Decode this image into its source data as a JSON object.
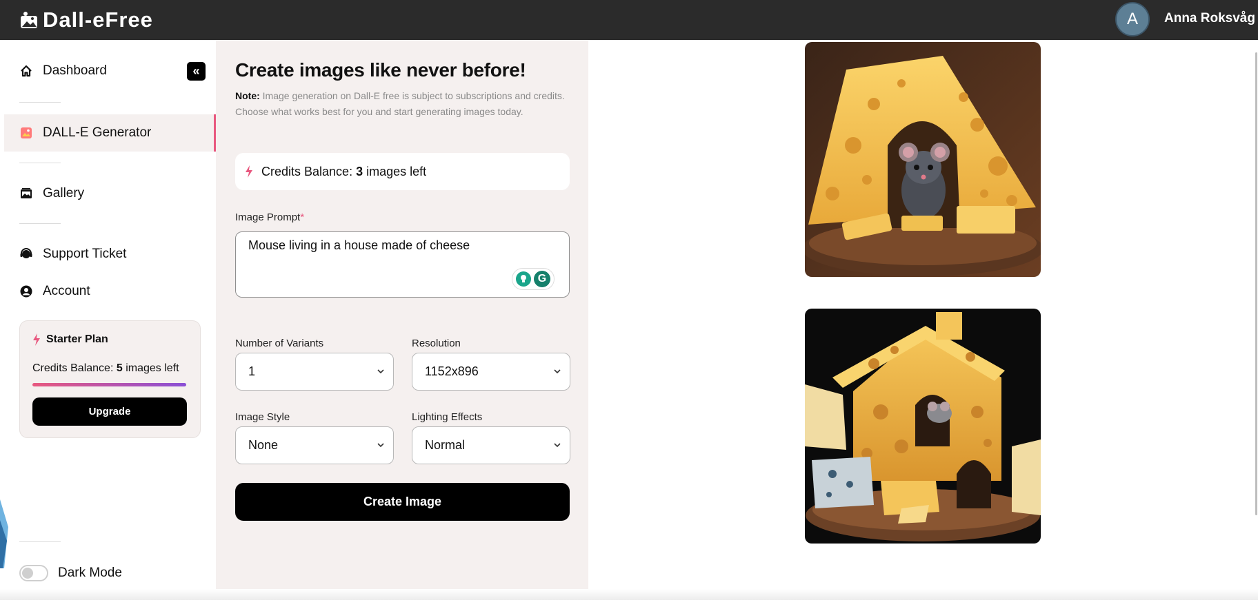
{
  "app": {
    "name": "Dall-eFree"
  },
  "user": {
    "initial": "A",
    "name": "Anna Roksvåg"
  },
  "sidebar": {
    "items": [
      {
        "label": "Dashboard",
        "icon": "home-icon"
      },
      {
        "label": "DALL-E Generator",
        "icon": "image-icon",
        "active": true
      },
      {
        "label": "Gallery",
        "icon": "gallery-icon"
      },
      {
        "label": "Support Ticket",
        "icon": "headset-icon"
      },
      {
        "label": "Account",
        "icon": "user-icon"
      }
    ],
    "collapse_symbol": "«",
    "plan": {
      "title": "Starter Plan",
      "credits_prefix": "Credits Balance: ",
      "credits_count": "5",
      "credits_suffix": " images left",
      "progress": 1.0,
      "upgrade_label": "Upgrade"
    },
    "dark_mode": {
      "label": "Dark Mode",
      "enabled": false
    }
  },
  "form": {
    "title": "Create images like never before!",
    "note_label": "Note:",
    "note_text": " Image generation on Dall-E free is subject to subscriptions and credits. Choose what works best for you and start generating images today.",
    "credits_prefix": "Credits Balance: ",
    "credits_count": "3",
    "credits_suffix": " images left",
    "prompt_label": "Image Prompt",
    "prompt_required": "*",
    "prompt_value": "Mouse living in a house made of cheese",
    "grammarly_letter": "G",
    "variants_label": "Number of Variants",
    "variants_value": "1",
    "resolution_label": "Resolution",
    "resolution_value": "1152x896",
    "style_label": "Image Style",
    "style_value": "None",
    "lighting_label": "Lighting Effects",
    "lighting_value": "Normal",
    "create_label": "Create Image"
  },
  "results": {
    "images": [
      {
        "name": "mouse-in-cheese-wedge"
      },
      {
        "name": "cheese-house-with-mouse"
      }
    ]
  },
  "colors": {
    "topbar": "#2b2b2b",
    "accent": "#e8587f",
    "panel": "#f5f0ef"
  }
}
